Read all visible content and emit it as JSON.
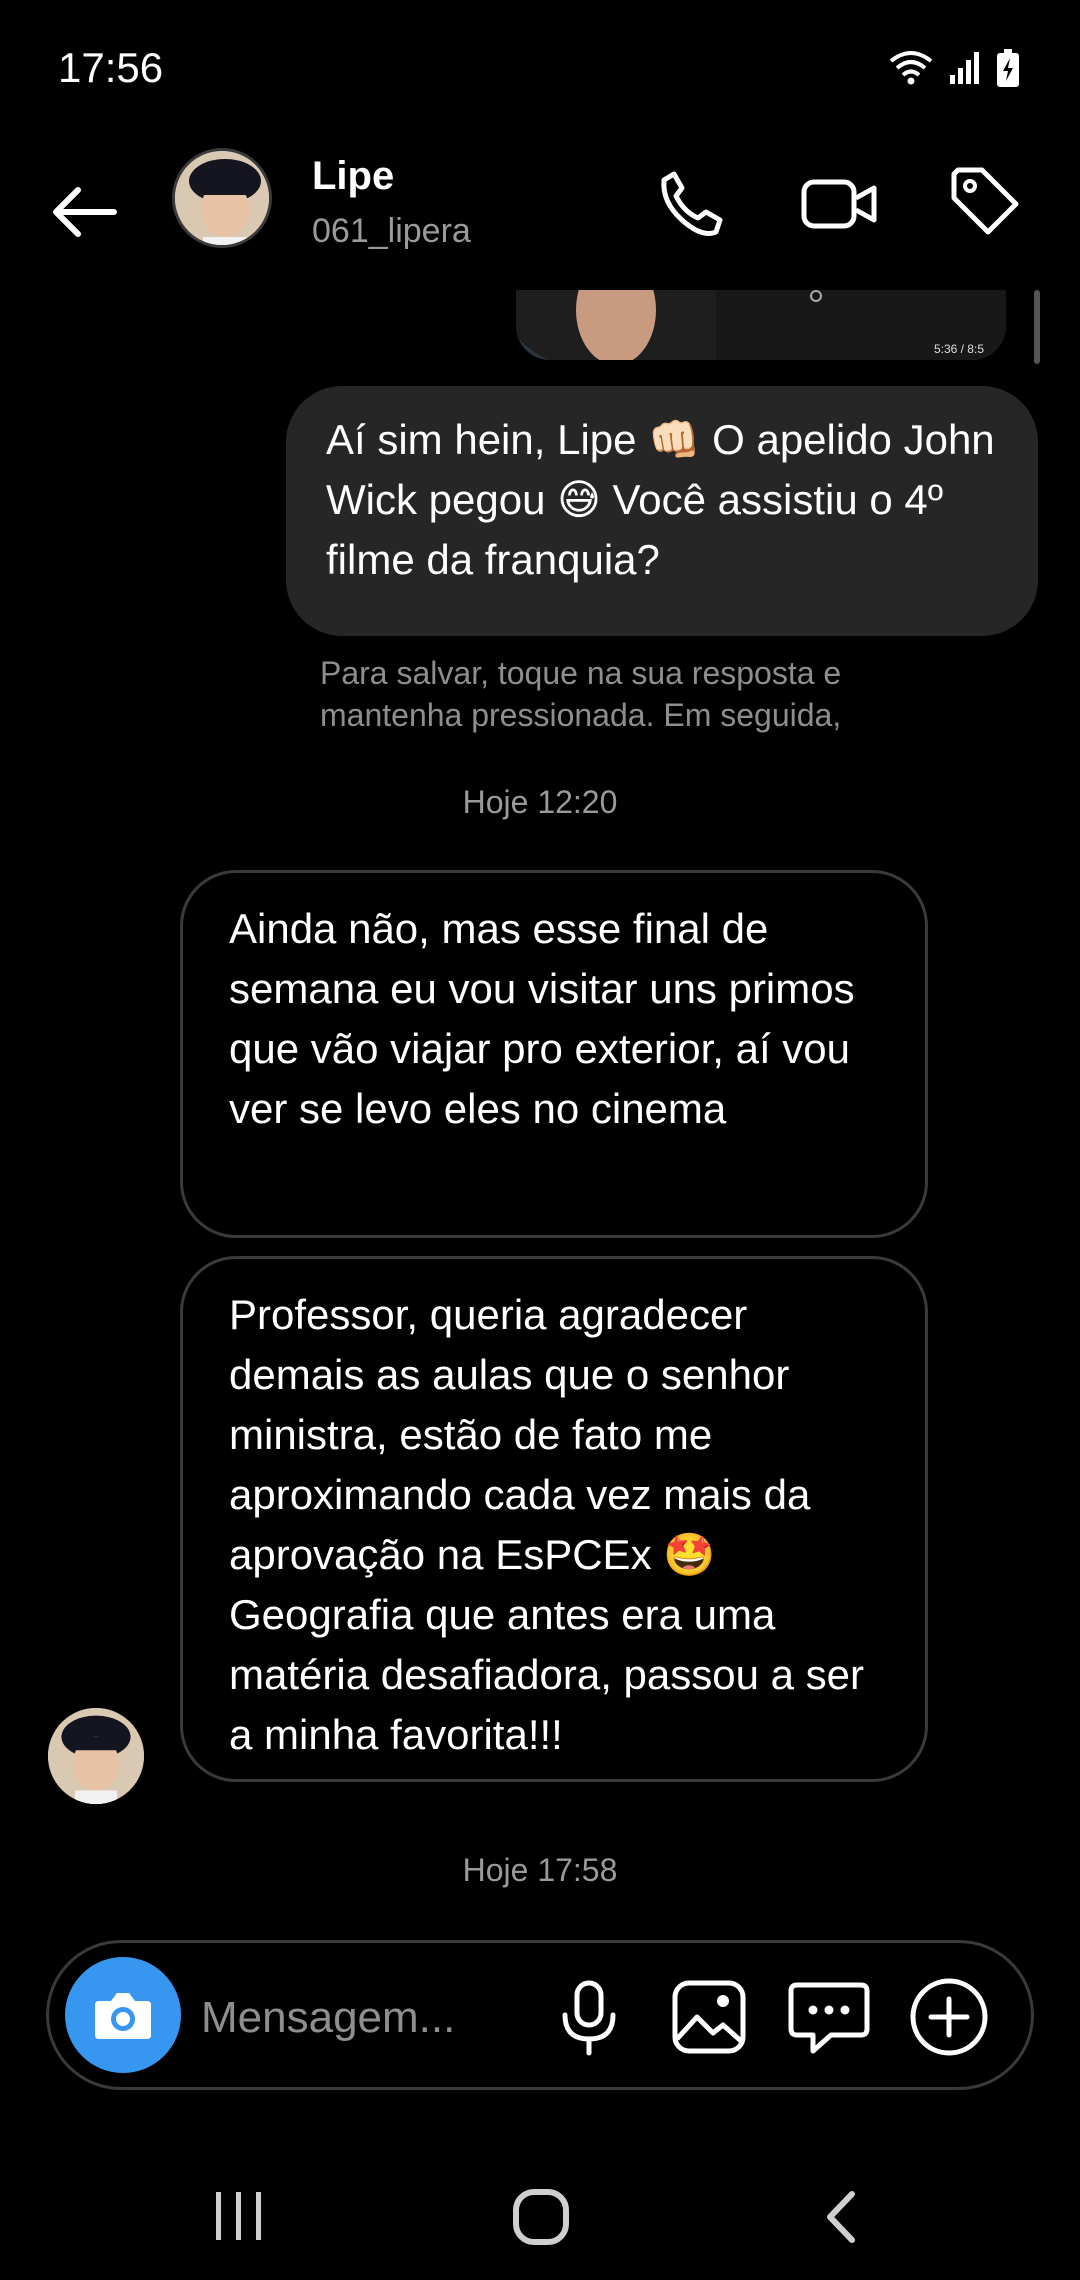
{
  "status_bar": {
    "time": "17:56"
  },
  "header": {
    "contact_name": "Lipe",
    "contact_username": "061_lipera"
  },
  "chat": {
    "media_caption": "5:36 / 8:5",
    "messages": [
      {
        "direction": "outgoing",
        "text": "Aí sim hein, Lipe 👊🏻 O apelido John Wick pegou 😅 Você assistiu o 4º filme da franquia?"
      },
      {
        "direction": "system",
        "text": "Para salvar, toque na sua resposta e mantenha pressionada. Em seguida,"
      },
      {
        "direction": "timestamp",
        "text": "Hoje 12:20"
      },
      {
        "direction": "incoming",
        "text": "Ainda não, mas esse final de semana eu vou visitar uns primos que vão viajar pro exterior, aí vou ver se levo eles no cinema"
      },
      {
        "direction": "incoming",
        "text": "Professor, queria agradecer demais as aulas que o senhor ministra, estão de fato me aproximando cada vez mais da aprovação na EsPCEx 🤩 Geografia que antes era uma matéria desafiadora, passou a ser a minha favorita!!!"
      },
      {
        "direction": "timestamp",
        "text": "Hoje 17:58"
      }
    ]
  },
  "composer": {
    "placeholder": "Mensagem..."
  },
  "colors": {
    "accent": "#3797f0",
    "bubble_out": "#262626",
    "border": "#3a3a3a"
  },
  "icons": [
    "wifi-icon",
    "signal-icon",
    "battery-icon",
    "back-arrow-icon",
    "phone-icon",
    "video-camera-icon",
    "tag-icon",
    "camera-icon",
    "microphone-icon",
    "image-icon",
    "sticker-icon",
    "plus-circle-icon",
    "recent-apps-icon",
    "home-icon",
    "nav-back-icon"
  ]
}
